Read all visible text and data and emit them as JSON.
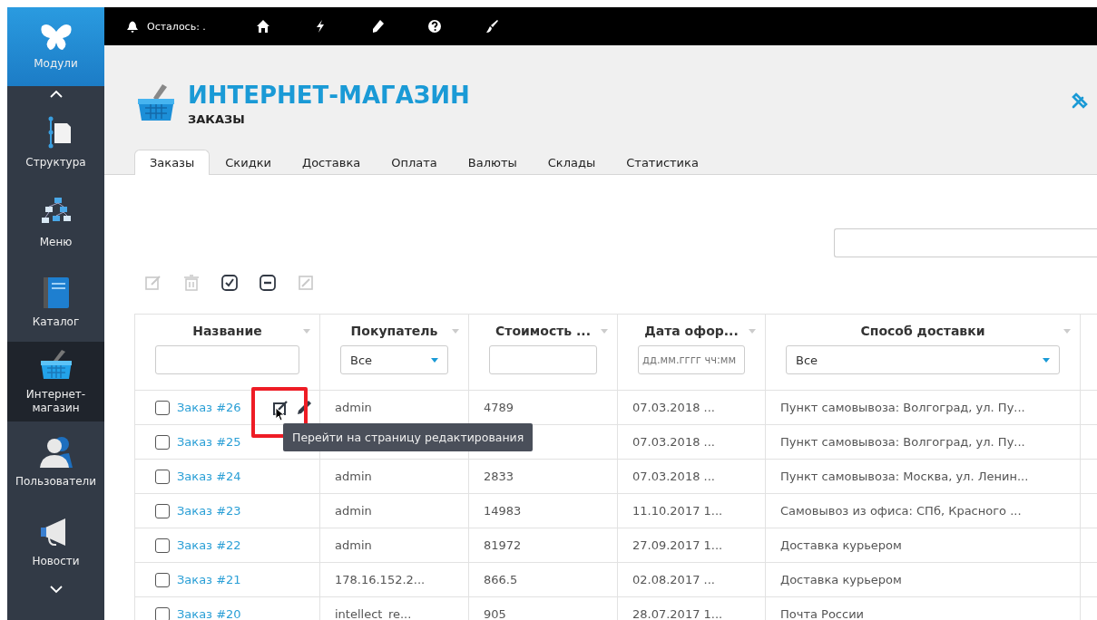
{
  "top_bar": {
    "notice": "Осталось: ."
  },
  "sidebar": {
    "modules_label": "Модули",
    "items": [
      {
        "label": "Структура",
        "kind": "structure",
        "selected": false
      },
      {
        "label": "Меню",
        "kind": "menu",
        "selected": false
      },
      {
        "label": "Каталог",
        "kind": "catalog",
        "selected": false
      },
      {
        "label": "Интернет-магазин",
        "kind": "shop",
        "selected": true
      },
      {
        "label": "Пользователи",
        "kind": "users",
        "selected": false
      },
      {
        "label": "Новости",
        "kind": "news",
        "selected": false
      }
    ]
  },
  "header": {
    "title": "ИНТЕРНЕТ-МАГАЗИН",
    "subtitle": "ЗАКАЗЫ"
  },
  "tabs": [
    {
      "label": "Заказы",
      "selected": true
    },
    {
      "label": "Скидки",
      "selected": false
    },
    {
      "label": "Доставка",
      "selected": false
    },
    {
      "label": "Оплата",
      "selected": false
    },
    {
      "label": "Валюты",
      "selected": false
    },
    {
      "label": "Склады",
      "selected": false
    },
    {
      "label": "Статистика",
      "selected": false
    }
  ],
  "toolbar": [
    {
      "kind": "edit",
      "disabled": true
    },
    {
      "kind": "delete",
      "disabled": true
    },
    {
      "kind": "select-all",
      "disabled": false
    },
    {
      "kind": "deselect",
      "disabled": false
    },
    {
      "kind": "image",
      "disabled": true
    }
  ],
  "table": {
    "columns": [
      {
        "title": "Название",
        "kind": "text"
      },
      {
        "title": "Покупатель",
        "kind": "select",
        "value": "Все"
      },
      {
        "title": "Стоимость ...",
        "kind": "text"
      },
      {
        "title": "Дата офор...",
        "kind": "date",
        "placeholder": "дд.мм.гггг чч:мм"
      },
      {
        "title": "Способ доставки",
        "kind": "select",
        "value": "Все"
      }
    ],
    "rows": [
      {
        "checked": false,
        "hovered": true,
        "cells": [
          "Заказ #26",
          "admin",
          "4789",
          "07.03.2018 ...",
          "Пункт самовывоза: Волгоград, ул. Пу..."
        ]
      },
      {
        "checked": false,
        "hovered": false,
        "cells": [
          "Заказ #25",
          null,
          null,
          "07.03.2018 ...",
          "Пункт самовывоза: Волгоград, ул. Пу..."
        ]
      },
      {
        "checked": false,
        "hovered": false,
        "cells": [
          "Заказ #24",
          "admin",
          "2833",
          "07.03.2018 ...",
          "Пункт самовывоза: Москва, ул. Ленин..."
        ]
      },
      {
        "checked": false,
        "hovered": false,
        "cells": [
          "Заказ #23",
          "admin",
          "14983",
          "11.10.2017 1...",
          "Самовывоз из офиса: СПб, Красного ..."
        ]
      },
      {
        "checked": false,
        "hovered": false,
        "cells": [
          "Заказ #22",
          "admin",
          "81972",
          "27.09.2017 1...",
          "Доставка курьером"
        ]
      },
      {
        "checked": false,
        "hovered": false,
        "cells": [
          "Заказ #21",
          "178.16.152.2...",
          "866.5",
          "02.08.2017 ...",
          "Доставка курьером"
        ]
      },
      {
        "checked": false,
        "hovered": false,
        "cells": [
          "Заказ #20",
          "intellect_re...",
          "905",
          "28.07.2017 1...",
          "Почта России"
        ]
      }
    ]
  },
  "tooltip": "Перейти на страницу редактирования"
}
